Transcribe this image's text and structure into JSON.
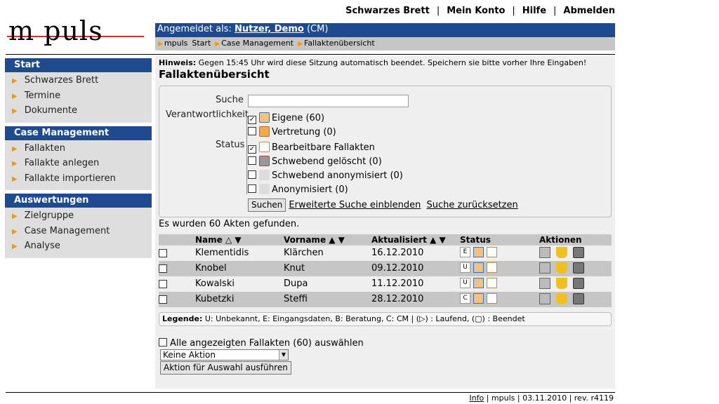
{
  "logo": {
    "text": "m puls"
  },
  "topnav": [
    "Schwarzes Brett",
    "Mein Konto",
    "Hilfe",
    "Abmelden"
  ],
  "login": {
    "prefix": "Angemeldet als:",
    "user": "Nutzer, Demo",
    "role": "(CM)"
  },
  "breadcrumb": [
    "mpuls",
    "Start",
    "Case Management",
    "Fallaktenübersicht"
  ],
  "sidebar": [
    {
      "title": "Start",
      "items": [
        "Schwarzes Brett",
        "Termine",
        "Dokumente"
      ]
    },
    {
      "title": "Case Management",
      "items": [
        "Fallakten",
        "Fallakte anlegen",
        "Fallakte importieren"
      ]
    },
    {
      "title": "Auswertungen",
      "items": [
        "Zielgruppe",
        "Case Management",
        "Analyse"
      ]
    }
  ],
  "hint": {
    "label": "Hinweis:",
    "text": "Gegen 15:45 Uhr wird diese Sitzung automatisch beendet. Speichern sie bitte vorher Ihre Eingaben!"
  },
  "page_title": "Fallaktenübersicht",
  "search": {
    "search_label": "Suche",
    "search_value": "",
    "resp_label": "Verantwortlichkeit",
    "status_label": "Status",
    "responsibility": [
      {
        "label": "Eigene (60)",
        "checked": true
      },
      {
        "label": "Vertretung (0)",
        "checked": false
      }
    ],
    "status": [
      {
        "label": "Bearbeitbare Fallakten",
        "checked": true
      },
      {
        "label": "Schwebend gelöscht (0)",
        "checked": false
      },
      {
        "label": "Schwebend anonymisiert (0)",
        "checked": false
      },
      {
        "label": "Anonymisiert (0)",
        "checked": false
      }
    ],
    "submit": "Suchen",
    "advanced": "Erweiterte Suche einblenden",
    "reset": "Suche zurücksetzen"
  },
  "found_text": "Es wurden 60 Akten gefunden.",
  "table": {
    "headers": {
      "name": "Name △ ▼",
      "vorname": "Vorname ▲ ▼",
      "updated": "Aktualisiert ▲ ▼",
      "status": "Status",
      "actions": "Aktionen"
    },
    "rows": [
      {
        "name": "Klementidis",
        "vorname": "Klärchen",
        "updated": "16.12.2010",
        "phase": "E"
      },
      {
        "name": "Knobel",
        "vorname": "Knut",
        "updated": "09.12.2010",
        "phase": "U"
      },
      {
        "name": "Kowalski",
        "vorname": "Dupa",
        "updated": "11.12.2010",
        "phase": "U"
      },
      {
        "name": "Kubetzki",
        "vorname": "Steffi",
        "updated": "28.12.2010",
        "phase": "C"
      }
    ]
  },
  "legend": {
    "label": "Legende:",
    "text": "U: Unbekannt, E: Eingangsdaten, B: Beratung, C: CM | (▷) : Laufend, (▢) : Beendet"
  },
  "select_all": "Alle angezeigten Fallakten (60) auswählen",
  "action_select": "Keine Aktion",
  "action_button": "Aktion für Auswahl ausführen",
  "footer": {
    "info": "Info",
    "rest": "| mpuls | 03.11.2010 | rev. r4119"
  },
  "colors": {
    "nav_blue": "#1e4b8f",
    "bar_gray": "#c6c6c6",
    "sidebar_gray": "#dedede",
    "content_gray": "#efefef",
    "arrow_orange": "#f09a00"
  }
}
